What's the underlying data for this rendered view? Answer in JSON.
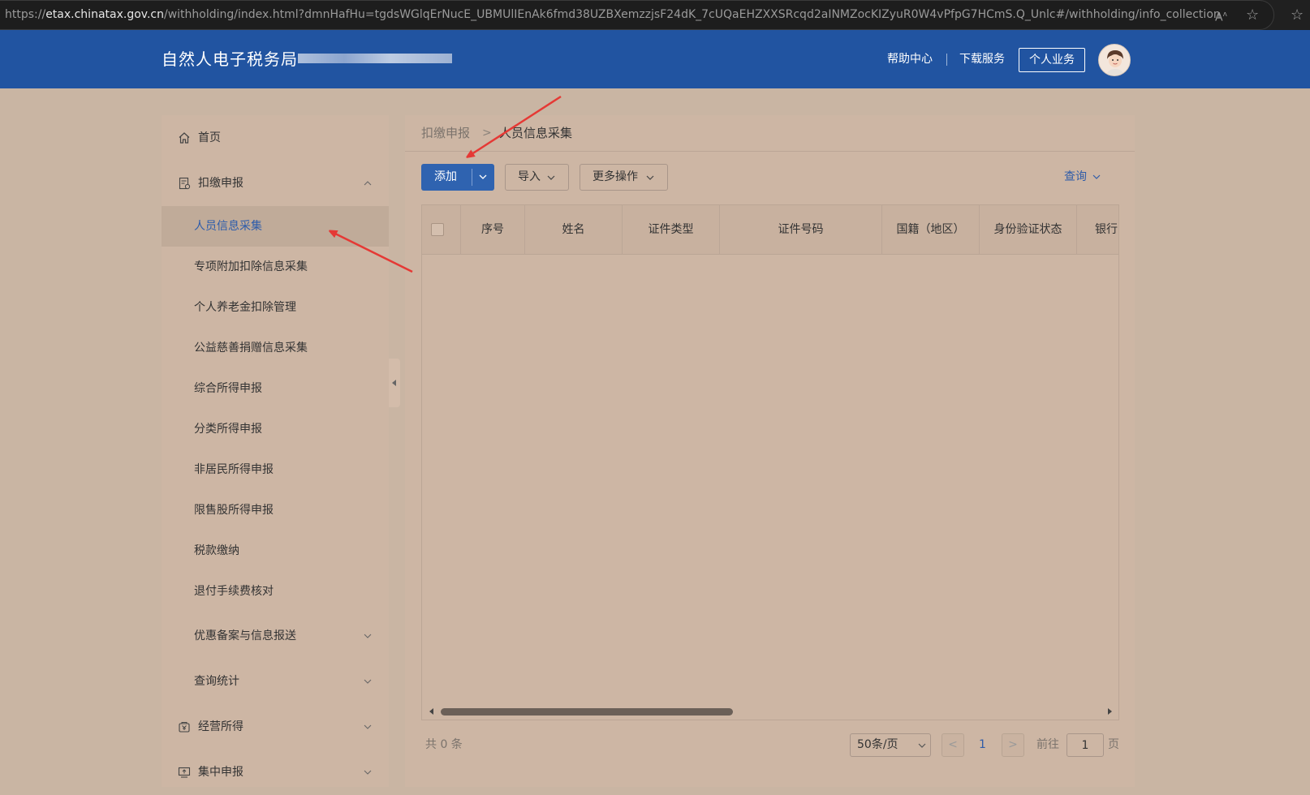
{
  "browser": {
    "url_prefix": "https://",
    "url_host": "etax.chinatax.gov.cn",
    "url_rest": "/withholding/index.html?dmnHafHu=tgdsWGlqErNucE_UBMUlIEnAk6fmd38UZBXemzzjsF24dK_7cUQaEHZXXSRcqd2aINMZocKIZyuR0W4vPfpG7HCmS.Q_Unlc#/withholding/info_collection",
    "read_aloud": "A̩ᵃ"
  },
  "header": {
    "title": "自然人电子税务局",
    "help": "帮助中心",
    "download": "下载服务",
    "personal": "个人业务"
  },
  "sidebar": {
    "home": "首页",
    "withholding": "扣缴申报",
    "items": [
      "人员信息采集",
      "专项附加扣除信息采集",
      "个人养老金扣除管理",
      "公益慈善捐赠信息采集",
      "综合所得申报",
      "分类所得申报",
      "非居民所得申报",
      "限售股所得申报",
      "税款缴纳",
      "退付手续费核对"
    ],
    "preferential": "优惠备案与信息报送",
    "query_stats": "查询统计",
    "business_income": "经营所得",
    "centralized": "集中申报"
  },
  "breadcrumb": {
    "parent": "扣缴申报",
    "separator": ">",
    "current": "人员信息采集"
  },
  "toolbar": {
    "add": "添加",
    "import": "导入",
    "more": "更多操作",
    "query": "查询"
  },
  "table": {
    "columns": [
      "序号",
      "姓名",
      "证件类型",
      "证件号码",
      "国籍（地区）",
      "身份验证状态",
      "银行"
    ]
  },
  "pagination": {
    "total": "共 0 条",
    "page_size": "50条/页",
    "prev": "<",
    "next": ">",
    "current_page": "1",
    "goto_label": "前往",
    "goto_value": "1",
    "page_unit": "页"
  },
  "colors": {
    "header_bg": "#2154a1",
    "accent": "#2f63b0",
    "annotation_arrow": "#e53935"
  }
}
